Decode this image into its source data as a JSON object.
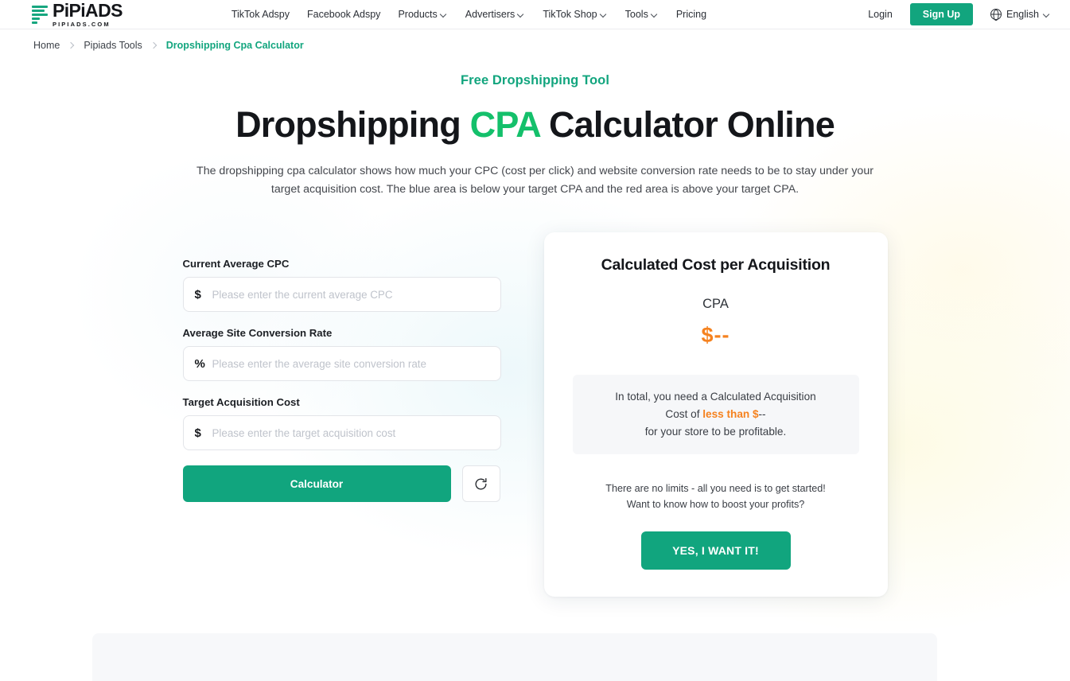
{
  "header": {
    "logo": {
      "name": "PiPiADS",
      "tagline": "PIPIADS.COM"
    },
    "nav": [
      {
        "label": "TikTok Adspy",
        "has_caret": false
      },
      {
        "label": "Facebook Adspy",
        "has_caret": false
      },
      {
        "label": "Products",
        "has_caret": true
      },
      {
        "label": "Advertisers",
        "has_caret": true
      },
      {
        "label": "TikTok Shop",
        "has_caret": true
      },
      {
        "label": "Tools",
        "has_caret": true
      },
      {
        "label": "Pricing",
        "has_caret": false
      }
    ],
    "login_label": "Login",
    "signup_label": "Sign Up",
    "language": "English"
  },
  "breadcrumb": [
    {
      "label": "Home"
    },
    {
      "label": "Pipiads Tools"
    },
    {
      "label": "Dropshipping Cpa Calculator"
    }
  ],
  "hero": {
    "eyebrow": "Free Dropshipping Tool",
    "title_part1": "Dropshipping ",
    "title_accent": "CPA",
    "title_part2": " Calculator Online",
    "description": "The dropshipping cpa calculator shows how much your CPC (cost per click) and website conversion rate needs to be to stay under your target acquisition cost. The blue area is below your target CPA and the red area is above your target CPA."
  },
  "form": {
    "fields": [
      {
        "label": "Current Average CPC",
        "prefix": "$",
        "value": "",
        "placeholder": "Please enter the current average CPC"
      },
      {
        "label": "Average Site Conversion Rate",
        "prefix": "%",
        "value": "",
        "placeholder": "Please enter the average site conversion rate"
      },
      {
        "label": "Target Acquisition Cost",
        "prefix": "$",
        "value": "",
        "placeholder": "Please enter the target acquisition cost"
      }
    ],
    "calculate_label": "Calculator",
    "reset_icon": "refresh-icon"
  },
  "result_card": {
    "title": "Calculated Cost per Acquisition",
    "cpa_label": "CPA",
    "cpa_value": "$--",
    "note_line1": "In total, you need a Calculated Acquisition",
    "note_line2_prefix": "Cost of ",
    "note_line2_highlight": "less than $",
    "note_line2_suffix": "--",
    "note_line3": "for your store to be profitable.",
    "tail_line1": "There are no limits - all you need is to get started!",
    "tail_line2": "Want to know how to boost your profits?",
    "cta_label": "YES, I WANT IT!"
  },
  "colors": {
    "brand_green": "#11a57e",
    "accent_green": "#14c06b",
    "orange": "#f5821f",
    "text_dark": "#14161a",
    "panel_gray": "#f7f8fa"
  }
}
